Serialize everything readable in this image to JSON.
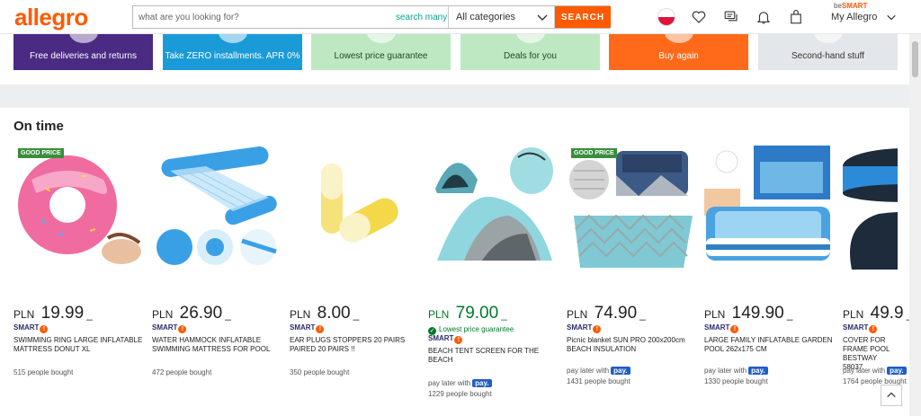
{
  "header": {
    "logo": "allegro",
    "search_placeholder": "what are you looking for?",
    "search_many": "search many",
    "category_select": "All categories",
    "search_button": "SEARCH",
    "besmart_prefix": "be",
    "besmart_brand": "SMART",
    "my_allegro": "My Allegro"
  },
  "tiles": [
    {
      "label": "Free deliveries and returns",
      "bg": "#4a2a82",
      "fg": "#ffffff"
    },
    {
      "label": "Take ZERO installments. APR 0%",
      "bg": "#1a9bd7",
      "fg": "#ffffff"
    },
    {
      "label": "Lowest price guarantee",
      "bg": "#bde8c2",
      "fg": "#1f4a25"
    },
    {
      "label": "Deals for you",
      "bg": "#bde8c2",
      "fg": "#1f4a25"
    },
    {
      "label": "Buy again",
      "bg": "#ff6a1a",
      "fg": "#ffffff"
    },
    {
      "label": "Second-hand stuff",
      "bg": "#e3e6ea",
      "fg": "#333333"
    }
  ],
  "section_title": "On time",
  "products": [
    {
      "badge": "GOOD PRICE",
      "currency": "PLN",
      "price": "19.99",
      "smart": "SMART",
      "title": "SWIMMING RING LARGE INFLATABLE MATTRESS DONUT XL",
      "bought": "515 people bought"
    },
    {
      "badge": "",
      "currency": "PLN",
      "price": "26.90",
      "smart": "SMART",
      "title": "WATER HAMMOCK INFLATABLE SWIMMING MATTRESS FOR POOL",
      "bought": "472 people bought"
    },
    {
      "badge": "",
      "currency": "PLN",
      "price": "8.00",
      "smart": "SMART",
      "title": "EAR PLUGS STOPPERS 20 PAIRS PAIRED 20 PAIRS !!",
      "bought": "350 people bought"
    },
    {
      "badge": "",
      "currency": "PLN",
      "price": "79.00",
      "smart": "SMART",
      "lowest": "Lowest price guarantee",
      "title": "BEACH TENT SCREEN FOR THE BEACH",
      "pay_later": "pay later with",
      "pay_brand": "pay.",
      "bought": "1229 people bought"
    },
    {
      "badge": "GOOD PRICE",
      "currency": "PLN",
      "price": "74.90",
      "smart": "SMART",
      "title": "Picnic blanket SUN PRO 200x200cm BEACH INSULATION",
      "pay_later": "pay later with",
      "pay_brand": "pay.",
      "bought": "1431 people bought"
    },
    {
      "badge": "",
      "currency": "PLN",
      "price": "149.90",
      "smart": "SMART",
      "title": "LARGE FAMILY INFLATABLE GARDEN POOL 262x175 CM",
      "pay_later": "pay later with",
      "pay_brand": "pay.",
      "bought": "1330 people bought"
    },
    {
      "badge": "",
      "currency": "PLN",
      "price": "49.9",
      "smart": "SMART",
      "title": "COVER FOR FRAME POOL BESTWAY 58037",
      "pay_later": "pay later with",
      "pay_brand": "pay.",
      "bought": "1764 people bought"
    }
  ],
  "colors": {
    "brand": "#ff5a00",
    "green_price": "#007a29"
  }
}
